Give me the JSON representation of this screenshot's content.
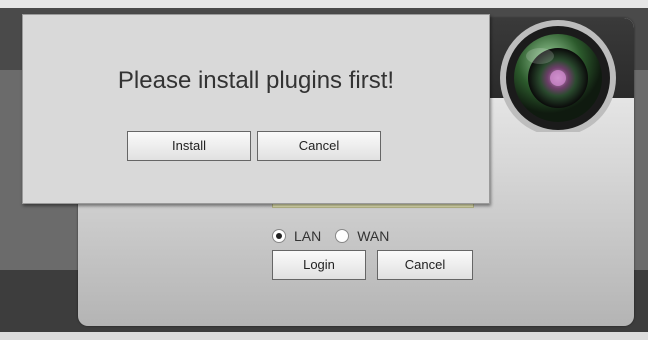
{
  "dialog": {
    "message": "Please install plugins first!",
    "install_label": "Install",
    "cancel_label": "Cancel"
  },
  "login": {
    "network_options": [
      {
        "label": "LAN",
        "selected": true
      },
      {
        "label": "WAN",
        "selected": false
      }
    ],
    "login_label": "Login",
    "cancel_label": "Cancel"
  },
  "colors": {
    "card_top": "#2a2a2a",
    "card_gradient_end": "#b4b4b4",
    "modal_bg": "#d9d9d9",
    "field_bg": "#e9e9b8"
  },
  "icons": {
    "lens": "camera-lens-icon"
  }
}
